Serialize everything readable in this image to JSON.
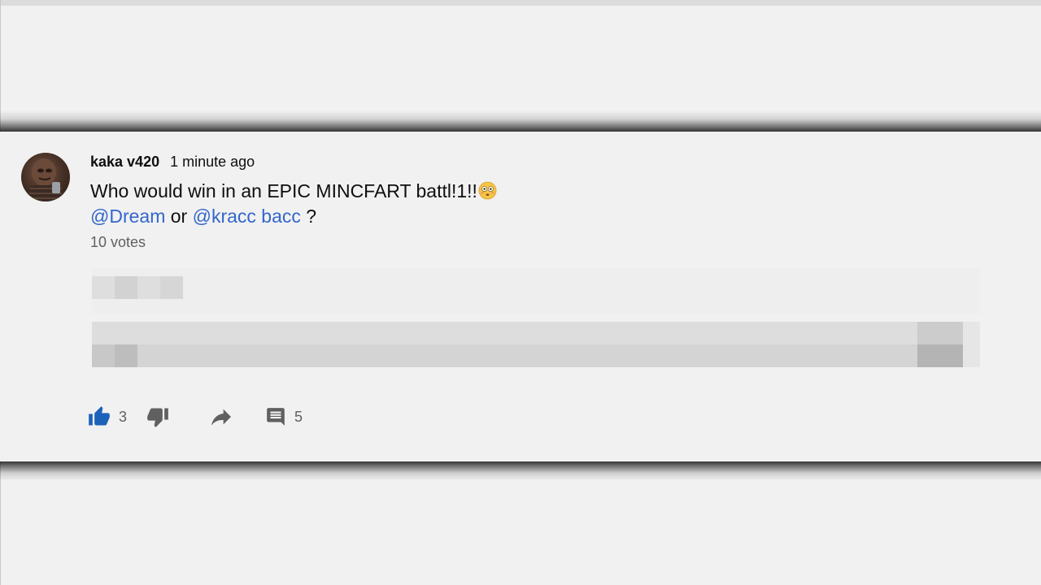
{
  "comment": {
    "author": "kaka v420",
    "time": "1 minute ago",
    "text_line1": "Who would win in an EPIC MINCFART battl!1!!",
    "mention1": "@Dream",
    "connector": " or ",
    "mention2": "@kracc bacc",
    "trailing": " ?",
    "votes": "10 votes"
  },
  "actions": {
    "like_count": "3",
    "reply_count": "5"
  },
  "icons": {
    "like": "thumbs-up-icon",
    "dislike": "thumbs-down-icon",
    "share": "share-arrow-icon",
    "reply": "comment-icon",
    "emoji": "flushed-face-emoji"
  },
  "colors": {
    "background": "#f1f1f1",
    "mention": "#3366cc",
    "like_active": "#1c62b9",
    "secondary_text": "#606060"
  }
}
